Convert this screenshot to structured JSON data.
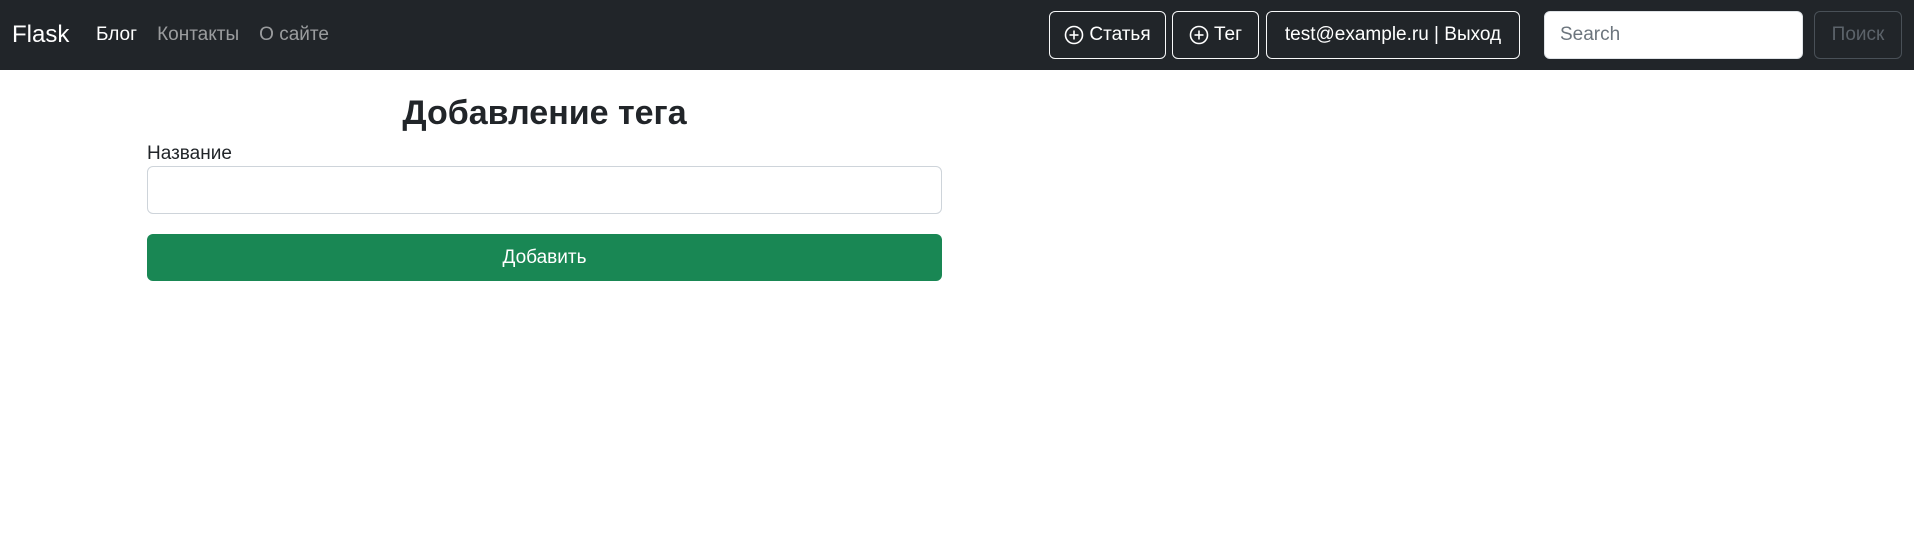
{
  "navbar": {
    "brand": "Flask",
    "links": [
      {
        "label": "Блог",
        "active": true
      },
      {
        "label": "Контакты",
        "active": false
      },
      {
        "label": "О сайте",
        "active": false
      }
    ],
    "add_article_label": "Статья",
    "add_tag_label": "Тег",
    "user_label": "test@example.ru | Выход",
    "search_placeholder": "Search",
    "search_button_label": "Поиск",
    "icons": {
      "add": "plus-circle-icon"
    },
    "colors": {
      "background": "#212529",
      "active_link": "#ffffff",
      "inactive_link": "rgba(255,255,255,0.55)"
    }
  },
  "form": {
    "title": "Добавление тега",
    "name_label": "Название",
    "name_value": "",
    "submit_label": "Добавить",
    "colors": {
      "submit": "#198754"
    }
  }
}
